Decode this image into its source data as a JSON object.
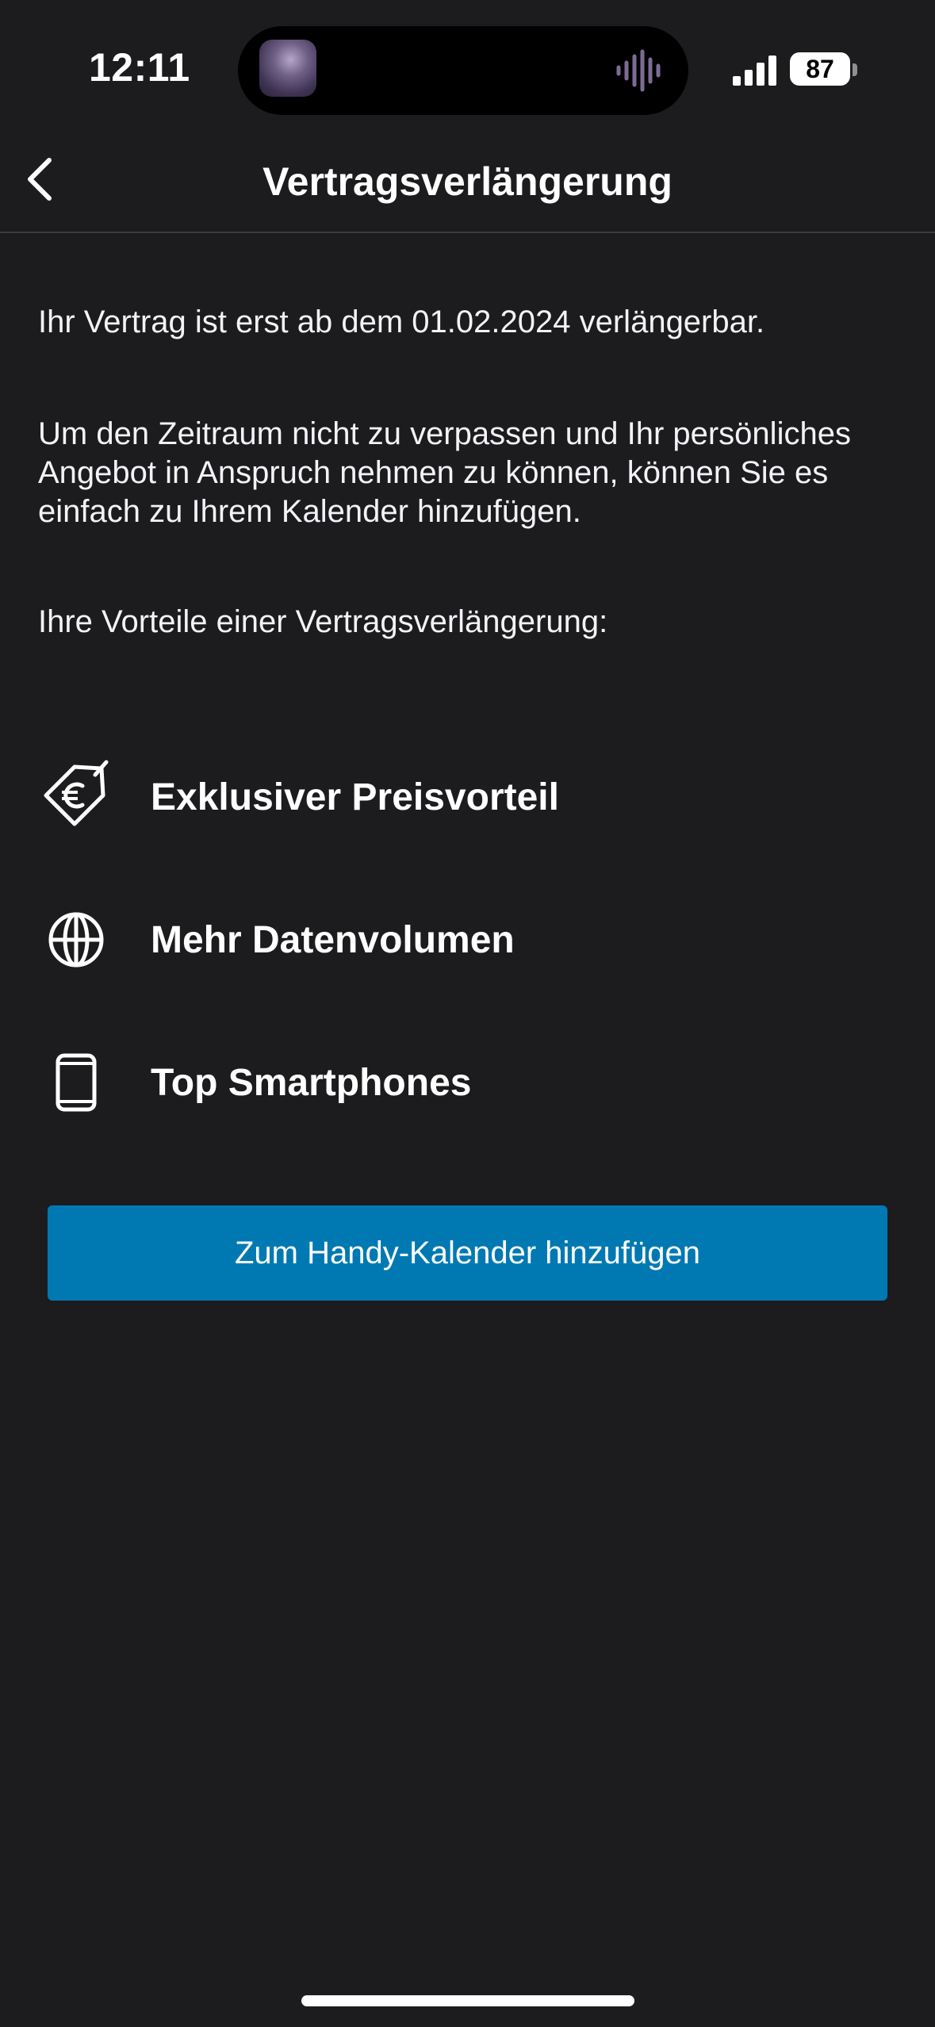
{
  "status_bar": {
    "time": "12:11",
    "battery": "87",
    "icons": {
      "signal": "cellular-signal-icon",
      "audio": "audio-waveform-icon"
    }
  },
  "header": {
    "title": "Vertragsverlängerung",
    "back_icon": "chevron-left-icon"
  },
  "content": {
    "info": "Ihr Vertrag ist erst ab dem 01.02.2024 verlängerbar.",
    "description": "Um den Zeitraum nicht zu verpassen und Ihr persönliches Angebot in Anspruch nehmen zu können, können Sie es einfach zu Ihrem Kalender hinzufügen.",
    "benefits_heading": "Ihre Vorteile einer Vertragsverlängerung:",
    "benefits": [
      {
        "label": "Exklusiver Preisvorteil",
        "icon": "euro-tag-icon"
      },
      {
        "label": "Mehr Datenvolumen",
        "icon": "globe-icon"
      },
      {
        "label": "Top Smartphones",
        "icon": "smartphone-icon"
      }
    ],
    "cta_label": "Zum Handy-Kalender hinzufügen"
  },
  "colors": {
    "background": "#1c1c1e",
    "accent": "#0079b3",
    "text": "#ffffff",
    "divider": "#3a3a3c"
  }
}
